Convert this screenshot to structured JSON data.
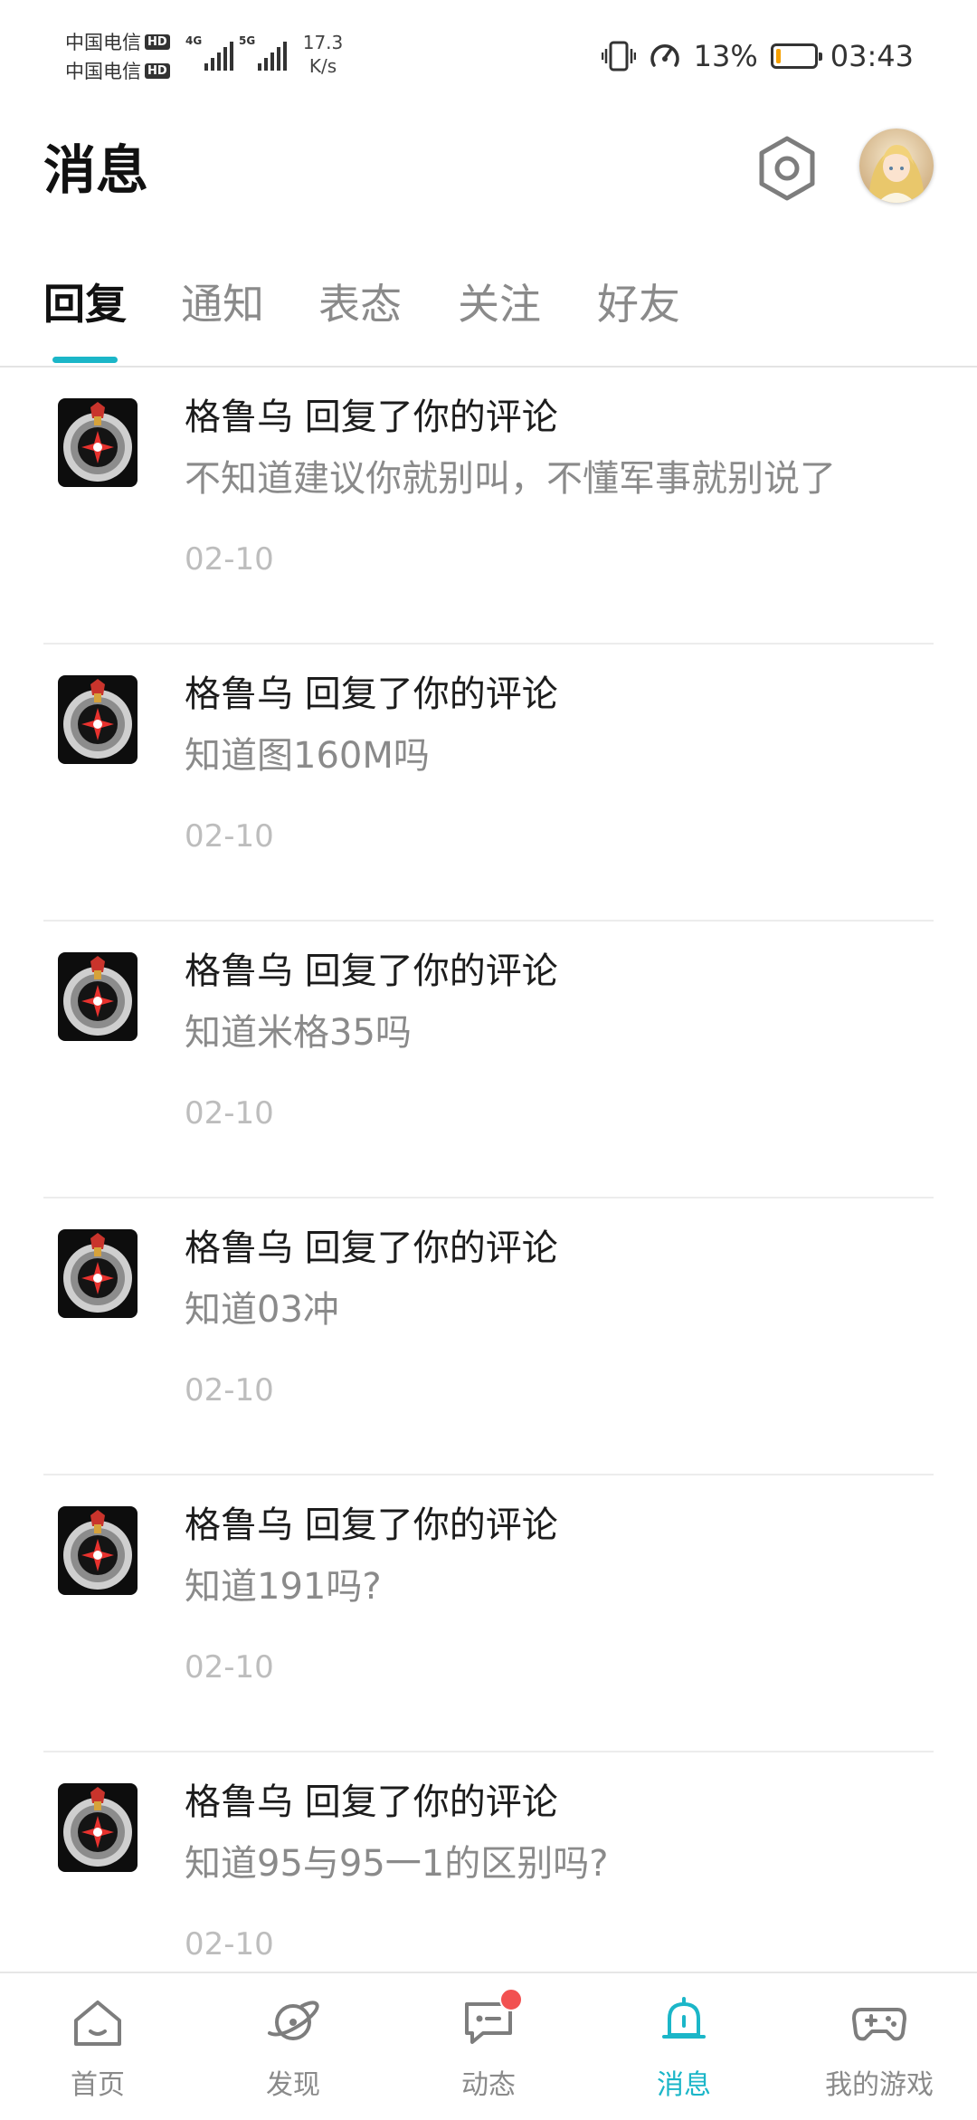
{
  "status_bar": {
    "carriers": [
      {
        "name": "中国电信",
        "badge": "HD"
      },
      {
        "name": "中国电信",
        "badge": "HD"
      }
    ],
    "network_tags": [
      "4G",
      "5G"
    ],
    "speed_value": "17.3",
    "speed_unit": "K/s",
    "battery_percent": "13%",
    "battery_level": 0.13,
    "time": "03:43",
    "icons": [
      "vibrate-icon",
      "speed-gauge-icon",
      "battery-icon"
    ]
  },
  "header": {
    "title": "消息",
    "settings_icon": "settings-hexagon-icon",
    "avatar_icon": "user-avatar"
  },
  "tabs": [
    {
      "label": "回复",
      "active": true
    },
    {
      "label": "通知",
      "active": false
    },
    {
      "label": "表态",
      "active": false
    },
    {
      "label": "关注",
      "active": false
    },
    {
      "label": "好友",
      "active": false
    }
  ],
  "messages": [
    {
      "title": "格鲁乌 回复了你的评论",
      "content": "不知道建议你就别叫，不懂军事就别说了",
      "date": "02-10"
    },
    {
      "title": "格鲁乌 回复了你的评论",
      "content": "知道图160M吗",
      "date": "02-10"
    },
    {
      "title": "格鲁乌 回复了你的评论",
      "content": "知道米格35吗",
      "date": "02-10"
    },
    {
      "title": "格鲁乌 回复了你的评论",
      "content": "知道03冲",
      "date": "02-10"
    },
    {
      "title": "格鲁乌 回复了你的评论",
      "content": "知道191吗?",
      "date": "02-10"
    },
    {
      "title": "格鲁乌 回复了你的评论",
      "content": "知道95与95一1的区别吗?",
      "date": "02-10"
    }
  ],
  "bottom_nav": [
    {
      "label": "首页",
      "icon": "home-icon",
      "active": false,
      "badge": false
    },
    {
      "label": "发现",
      "icon": "planet-icon",
      "active": false,
      "badge": false
    },
    {
      "label": "动态",
      "icon": "chat-bubble-icon",
      "active": false,
      "badge": true
    },
    {
      "label": "消息",
      "icon": "bell-icon",
      "active": true,
      "badge": false
    },
    {
      "label": "我的游戏",
      "icon": "gamepad-icon",
      "active": false,
      "badge": false
    }
  ],
  "colors": {
    "accent": "#1bb6c8",
    "badge": "#f25151",
    "battery": "#f5a000",
    "text_primary": "#1c1c1c",
    "text_secondary": "#8a8a8a",
    "text_muted": "#bdbdbd"
  }
}
